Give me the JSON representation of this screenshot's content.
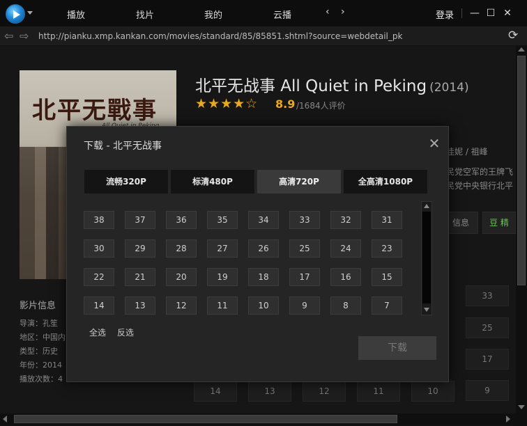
{
  "titlebar": {
    "nav": [
      "播放",
      "找片",
      "我的",
      "云播"
    ],
    "arrows": "‹ ›",
    "login": "登录"
  },
  "addressbar": {
    "url": "http://pianku.xmp.kankan.com/movies/standard/85/85851.shtml?source=webdetail_pk"
  },
  "movie": {
    "title": "北平无战事 All Quiet in Peking",
    "year": "(2014)",
    "stars": "★★★★☆",
    "rating_out_of_5": 4.5,
    "score": "8.9",
    "votes": "/1684人评价",
    "poster_title": "北平无戰事",
    "poster_subtitle": "All Quiet in Peking"
  },
  "info": {
    "label": "影片信息",
    "rows": [
      "导演：孔笙",
      "地区：中国内",
      "类型：历史",
      "年份：2014",
      "播放次数：4"
    ]
  },
  "background_right": {
    "cast_fragment": "佳妮 / 祖峰",
    "desc_line1": "民党空军的王牌飞",
    "desc_line2": "民党中央银行北平",
    "info_btn": "信息",
    "douban_btn": "豆 精",
    "cells": [
      "33",
      "25",
      "17",
      "9"
    ],
    "bottom_row": [
      "14",
      "13",
      "12",
      "11",
      "10",
      "9"
    ]
  },
  "modal": {
    "title": "下载 - 北平无战事",
    "tabs": [
      "流畅320P",
      "标清480P",
      "高清720P",
      "全高清1080P"
    ],
    "active_tab": 2,
    "episodes": [
      [
        "38",
        "37",
        "36",
        "35",
        "34",
        "33",
        "32",
        "31"
      ],
      [
        "30",
        "29",
        "28",
        "27",
        "26",
        "25",
        "24",
        "23"
      ],
      [
        "22",
        "21",
        "20",
        "19",
        "18",
        "17",
        "16",
        "15"
      ],
      [
        "14",
        "13",
        "12",
        "11",
        "10",
        "9",
        "8",
        "7"
      ]
    ],
    "select_all": "全选",
    "invert_select": "反选",
    "download": "下载"
  }
}
